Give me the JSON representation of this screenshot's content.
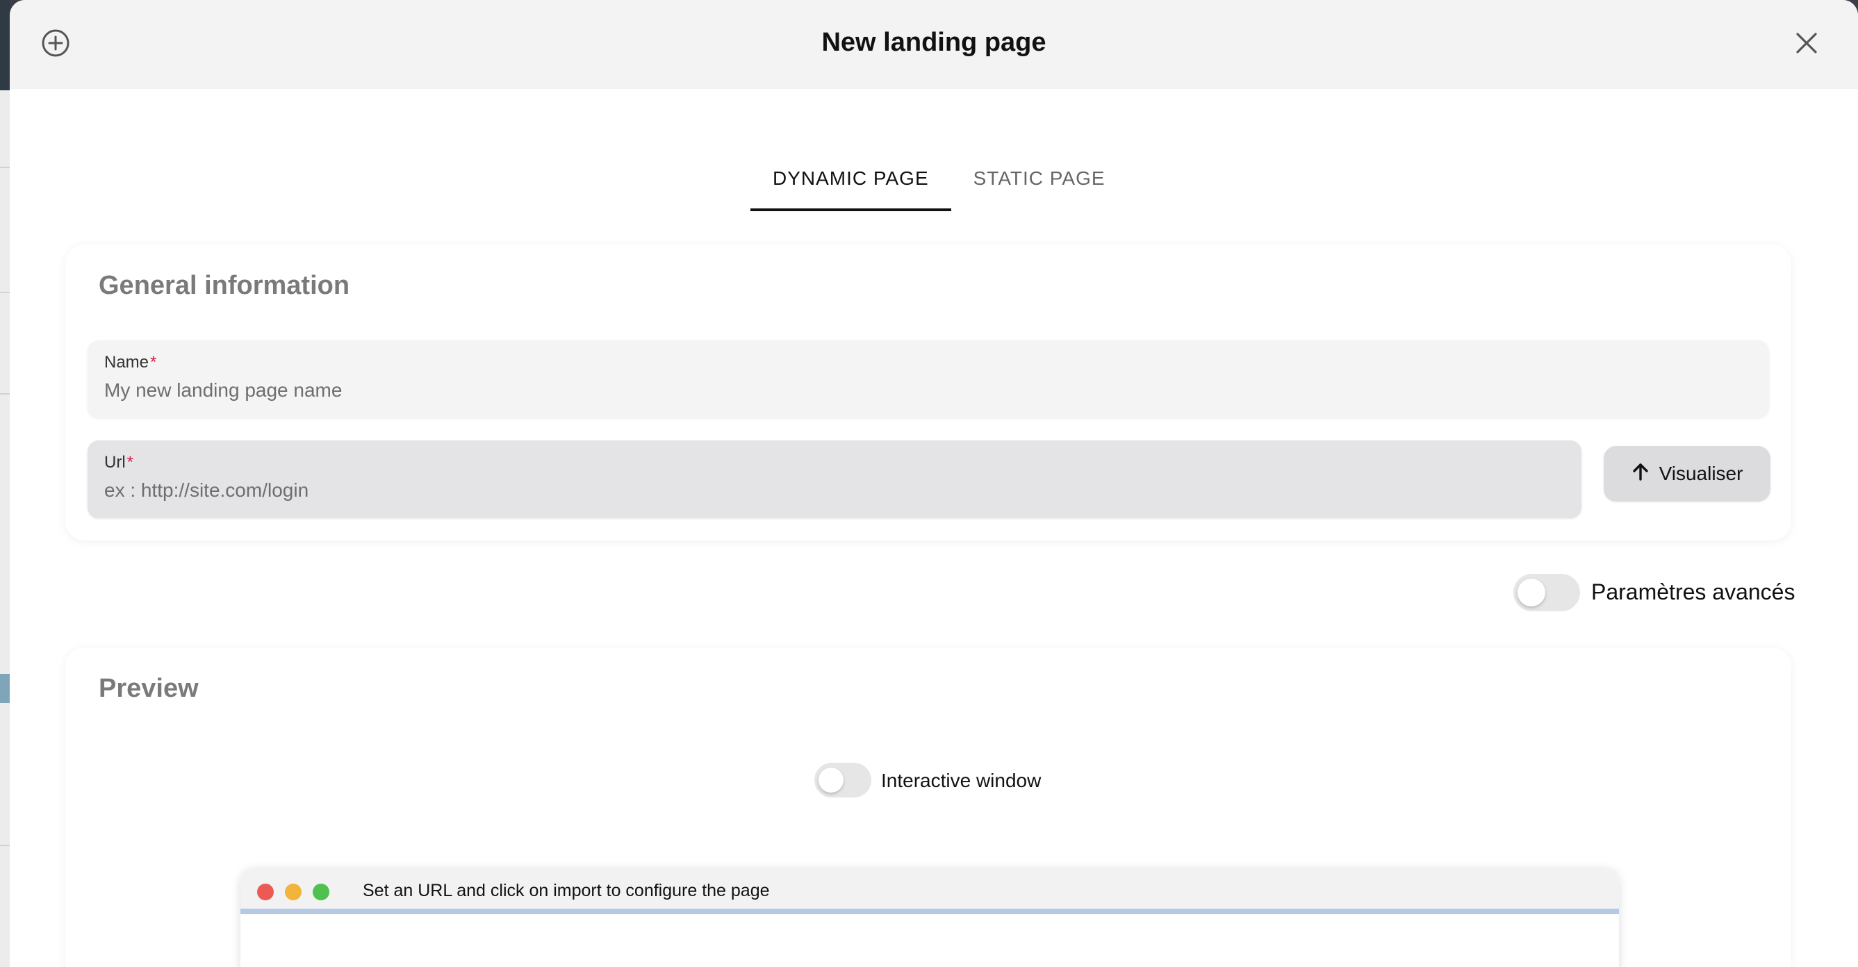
{
  "modal": {
    "title": "New landing page",
    "add_icon": "plus-circle-icon",
    "close_icon": "close-icon"
  },
  "tabs": [
    {
      "label": "DYNAMIC PAGE",
      "active": true
    },
    {
      "label": "STATIC PAGE",
      "active": false
    }
  ],
  "general": {
    "title": "General information",
    "name_field": {
      "label": "Name",
      "required_mark": "*",
      "placeholder": "My new landing page name",
      "value": ""
    },
    "url_field": {
      "label": "Url",
      "required_mark": "*",
      "placeholder": "ex : http://site.com/login",
      "value": ""
    },
    "visualiser_button": {
      "label": "Visualiser",
      "icon": "arrow-up-icon"
    }
  },
  "advanced_toggle": {
    "label": "Paramètres avancés",
    "on": false
  },
  "preview": {
    "title": "Preview",
    "interactive_toggle": {
      "label": "Interactive window",
      "on": false
    },
    "browser": {
      "message": "Set an URL and click on import to configure the page"
    }
  },
  "colors": {
    "accent": "#111111",
    "required": "#d81b48",
    "progress": "#b5c9e6",
    "traffic_red": "#ec5a55",
    "traffic_yellow": "#f2b43a",
    "traffic_green": "#4fc14e"
  }
}
